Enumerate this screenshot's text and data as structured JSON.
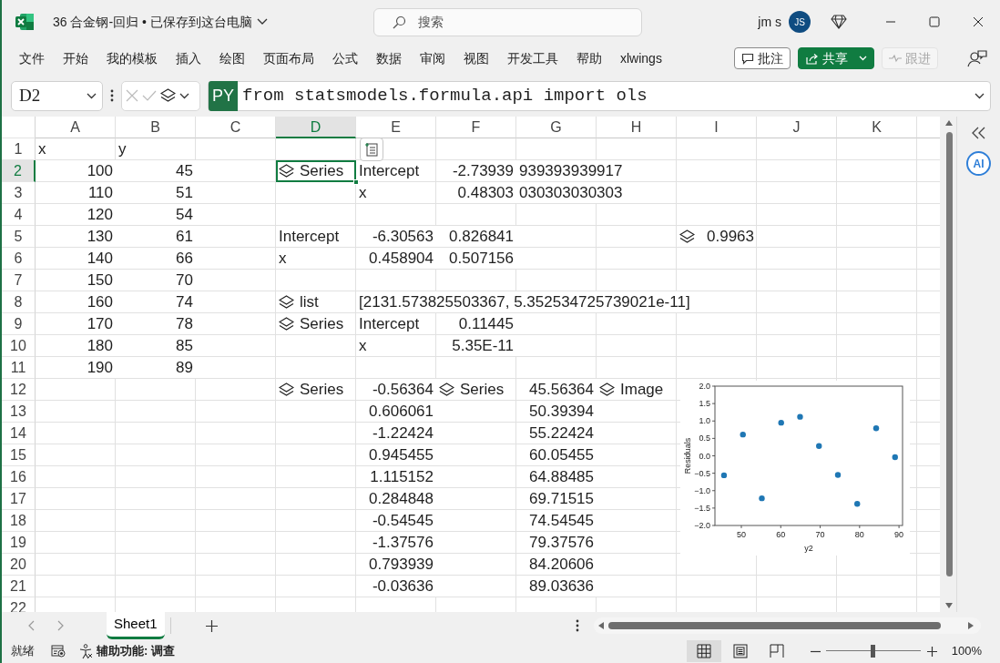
{
  "window": {
    "title": "36 合金钢-回归 • 已保存到这台电脑",
    "search": {
      "placeholder": "搜索"
    },
    "user": "jm s",
    "avatar": "JS"
  },
  "menu": [
    "文件",
    "开始",
    "我的模板",
    "插入",
    "绘图",
    "页面布局",
    "公式",
    "数据",
    "审阅",
    "视图",
    "开发工具",
    "帮助",
    "xlwings"
  ],
  "ribbon_buttons": [
    {
      "label": "批注",
      "kind": "outline",
      "disabled": false
    },
    {
      "label": "共享",
      "kind": "primary",
      "disabled": false
    },
    {
      "label": "跟进",
      "kind": "plain",
      "disabled": true
    }
  ],
  "formula_bar": {
    "name_box": "D2",
    "badge": "PY",
    "formula": "from statsmodels.formula.api import ols"
  },
  "grid": {
    "columns": [
      {
        "label": "A",
        "selected": false
      },
      {
        "label": "B",
        "selected": false
      },
      {
        "label": "C",
        "selected": false
      },
      {
        "label": "D",
        "selected": true
      },
      {
        "label": "E",
        "selected": false
      },
      {
        "label": "F",
        "selected": false
      },
      {
        "label": "G",
        "selected": false
      },
      {
        "label": "H",
        "selected": false
      },
      {
        "label": "I",
        "selected": false
      },
      {
        "label": "J",
        "selected": false
      },
      {
        "label": "K",
        "selected": false
      }
    ],
    "rows": [
      {
        "label": "1",
        "selected": false,
        "cells": [
          {
            "kind": "text",
            "text": "x"
          },
          {
            "kind": "text",
            "text": "y"
          }
        ]
      },
      {
        "label": "2",
        "selected": true,
        "cells": [
          {
            "kind": "number",
            "text": "100"
          },
          {
            "kind": "number",
            "text": "45"
          },
          {
            "kind": "empty"
          },
          {
            "kind": "python",
            "text": "Series"
          },
          {
            "kind": "text",
            "text": "Intercept"
          },
          {
            "kind": "number",
            "text": "-2.73939"
          },
          {
            "kind": "text",
            "text": "939393939917"
          }
        ]
      },
      {
        "label": "3",
        "selected": false,
        "cells": [
          {
            "kind": "number",
            "text": "110"
          },
          {
            "kind": "number",
            "text": "51"
          },
          {
            "kind": "empty"
          },
          {
            "kind": "empty"
          },
          {
            "kind": "text",
            "text": "x"
          },
          {
            "kind": "number",
            "text": "0.48303"
          },
          {
            "kind": "text",
            "text": "030303030303"
          }
        ]
      },
      {
        "label": "4",
        "selected": false,
        "cells": [
          {
            "kind": "number",
            "text": "120"
          },
          {
            "kind": "number",
            "text": "54"
          }
        ]
      },
      {
        "label": "5",
        "selected": false,
        "cells": [
          {
            "kind": "number",
            "text": "130"
          },
          {
            "kind": "number",
            "text": "61"
          },
          {
            "kind": "empty"
          },
          {
            "kind": "text",
            "text": "Intercept"
          },
          {
            "kind": "number",
            "text": "-6.30563"
          },
          {
            "kind": "number",
            "text": "0.826841"
          },
          {
            "kind": "empty"
          },
          {
            "kind": "empty"
          },
          {
            "kind": "python_number",
            "text": "0.9963"
          }
        ]
      },
      {
        "label": "6",
        "selected": false,
        "cells": [
          {
            "kind": "number",
            "text": "140"
          },
          {
            "kind": "number",
            "text": "66"
          },
          {
            "kind": "empty"
          },
          {
            "kind": "text",
            "text": "x"
          },
          {
            "kind": "number",
            "text": "0.458904"
          },
          {
            "kind": "number",
            "text": "0.507156"
          }
        ]
      },
      {
        "label": "7",
        "selected": false,
        "cells": [
          {
            "kind": "number",
            "text": "150"
          },
          {
            "kind": "number",
            "text": "70"
          }
        ]
      },
      {
        "label": "8",
        "selected": false,
        "cells": [
          {
            "kind": "number",
            "text": "160"
          },
          {
            "kind": "number",
            "text": "74"
          },
          {
            "kind": "empty"
          },
          {
            "kind": "python",
            "text": "list"
          },
          {
            "kind": "text",
            "text": "[2131.573825503367, 5.352534725739021e-11]"
          }
        ]
      },
      {
        "label": "9",
        "selected": false,
        "cells": [
          {
            "kind": "number",
            "text": "170"
          },
          {
            "kind": "number",
            "text": "78"
          },
          {
            "kind": "empty"
          },
          {
            "kind": "python",
            "text": "Series"
          },
          {
            "kind": "text",
            "text": "Intercept"
          },
          {
            "kind": "number",
            "text": "0.11445"
          }
        ]
      },
      {
        "label": "10",
        "selected": false,
        "cells": [
          {
            "kind": "number",
            "text": "180"
          },
          {
            "kind": "number",
            "text": "85"
          },
          {
            "kind": "empty"
          },
          {
            "kind": "empty"
          },
          {
            "kind": "text",
            "text": "x"
          },
          {
            "kind": "number",
            "text": "5.35E-11"
          }
        ]
      },
      {
        "label": "11",
        "selected": false,
        "cells": [
          {
            "kind": "number",
            "text": "190"
          },
          {
            "kind": "number",
            "text": "89"
          }
        ]
      },
      {
        "label": "12",
        "selected": false,
        "cells": [
          {
            "kind": "empty"
          },
          {
            "kind": "empty"
          },
          {
            "kind": "empty"
          },
          {
            "kind": "python",
            "text": "Series"
          },
          {
            "kind": "number",
            "text": "-0.56364"
          },
          {
            "kind": "python",
            "text": "Series"
          },
          {
            "kind": "number",
            "text": "45.56364"
          },
          {
            "kind": "python",
            "text": "Image"
          }
        ]
      },
      {
        "label": "13",
        "selected": false,
        "cells": [
          {
            "kind": "empty"
          },
          {
            "kind": "empty"
          },
          {
            "kind": "empty"
          },
          {
            "kind": "empty"
          },
          {
            "kind": "number",
            "text": "0.606061"
          },
          {
            "kind": "empty"
          },
          {
            "kind": "number",
            "text": "50.39394"
          }
        ]
      },
      {
        "label": "14",
        "selected": false,
        "cells": [
          {
            "kind": "empty"
          },
          {
            "kind": "empty"
          },
          {
            "kind": "empty"
          },
          {
            "kind": "empty"
          },
          {
            "kind": "number",
            "text": "-1.22424"
          },
          {
            "kind": "empty"
          },
          {
            "kind": "number",
            "text": "55.22424"
          }
        ]
      },
      {
        "label": "15",
        "selected": false,
        "cells": [
          {
            "kind": "empty"
          },
          {
            "kind": "empty"
          },
          {
            "kind": "empty"
          },
          {
            "kind": "empty"
          },
          {
            "kind": "number",
            "text": "0.945455"
          },
          {
            "kind": "empty"
          },
          {
            "kind": "number",
            "text": "60.05455"
          }
        ]
      },
      {
        "label": "16",
        "selected": false,
        "cells": [
          {
            "kind": "empty"
          },
          {
            "kind": "empty"
          },
          {
            "kind": "empty"
          },
          {
            "kind": "empty"
          },
          {
            "kind": "number",
            "text": "1.115152"
          },
          {
            "kind": "empty"
          },
          {
            "kind": "number",
            "text": "64.88485"
          }
        ]
      },
      {
        "label": "17",
        "selected": false,
        "cells": [
          {
            "kind": "empty"
          },
          {
            "kind": "empty"
          },
          {
            "kind": "empty"
          },
          {
            "kind": "empty"
          },
          {
            "kind": "number",
            "text": "0.284848"
          },
          {
            "kind": "empty"
          },
          {
            "kind": "number",
            "text": "69.71515"
          }
        ]
      },
      {
        "label": "18",
        "selected": false,
        "cells": [
          {
            "kind": "empty"
          },
          {
            "kind": "empty"
          },
          {
            "kind": "empty"
          },
          {
            "kind": "empty"
          },
          {
            "kind": "number",
            "text": "-0.54545"
          },
          {
            "kind": "empty"
          },
          {
            "kind": "number",
            "text": "74.54545"
          }
        ]
      },
      {
        "label": "19",
        "selected": false,
        "cells": [
          {
            "kind": "empty"
          },
          {
            "kind": "empty"
          },
          {
            "kind": "empty"
          },
          {
            "kind": "empty"
          },
          {
            "kind": "number",
            "text": "-1.37576"
          },
          {
            "kind": "empty"
          },
          {
            "kind": "number",
            "text": "79.37576"
          }
        ]
      },
      {
        "label": "20",
        "selected": false,
        "cells": [
          {
            "kind": "empty"
          },
          {
            "kind": "empty"
          },
          {
            "kind": "empty"
          },
          {
            "kind": "empty"
          },
          {
            "kind": "number",
            "text": "0.793939"
          },
          {
            "kind": "empty"
          },
          {
            "kind": "number",
            "text": "84.20606"
          }
        ]
      },
      {
        "label": "21",
        "selected": false,
        "cells": [
          {
            "kind": "empty"
          },
          {
            "kind": "empty"
          },
          {
            "kind": "empty"
          },
          {
            "kind": "empty"
          },
          {
            "kind": "number",
            "text": "-0.03636"
          },
          {
            "kind": "empty"
          },
          {
            "kind": "number",
            "text": "89.03636"
          }
        ]
      },
      {
        "label": "22",
        "selected": false
      }
    ]
  },
  "chart": {
    "chart_data": {
      "type": "scatter",
      "xlabel": "y2",
      "ylabel": "Residuals",
      "x": [
        45.6,
        50.4,
        55.2,
        60.1,
        64.9,
        69.7,
        74.5,
        79.4,
        84.2,
        89.0
      ],
      "series": [
        {
          "color": "#1f77b4",
          "values": [
            -0.56,
            0.61,
            -1.22,
            0.95,
            1.12,
            0.28,
            -0.55,
            -1.38,
            0.79,
            -0.04
          ]
        }
      ],
      "xlim": [
        43.3,
        90.9
      ],
      "ylim": [
        -2,
        2
      ],
      "xticks": [
        50,
        60,
        70,
        80,
        90
      ],
      "yticks": [
        {
          "value": -2,
          "label": "−2.0"
        },
        {
          "value": -1.5,
          "label": "−1.5"
        },
        {
          "value": -1,
          "label": "−1.0"
        },
        {
          "value": -0.5,
          "label": "−0.5"
        },
        {
          "value": 0,
          "label": "0.0"
        },
        {
          "value": 0.5,
          "label": "0.5"
        },
        {
          "value": 1,
          "label": "1.0"
        },
        {
          "value": 1.5,
          "label": "1.5"
        },
        {
          "value": 2,
          "label": "2.0"
        }
      ]
    }
  },
  "side_pane": {
    "ai_label": "AI"
  },
  "sheet_tabs": [
    {
      "label": "Sheet1",
      "selected": true
    }
  ],
  "status_bar": {
    "ready": "就绪",
    "accessibility": "辅助功能: 调查",
    "views": [
      {
        "kind": "normal",
        "selected": true
      },
      {
        "kind": "page_layout",
        "selected": false
      },
      {
        "kind": "page_break",
        "selected": false
      }
    ],
    "zoom": {
      "level": 0.5,
      "reading": "100%"
    }
  }
}
